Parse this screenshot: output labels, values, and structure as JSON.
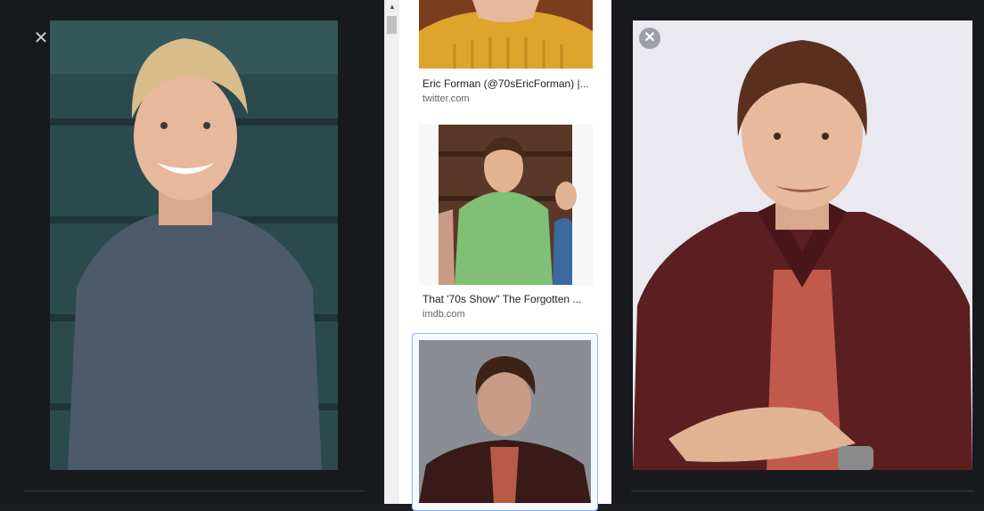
{
  "left_panel": {
    "close_icon": "✕"
  },
  "results": [
    {
      "title": "Eric Forman (@70sEricForman) |...",
      "domain": "twitter.com"
    },
    {
      "title": "That '70s Show\" The Forgotten ...",
      "domain": "imdb.com"
    }
  ],
  "right_panel": {
    "close_icon": "✕"
  }
}
